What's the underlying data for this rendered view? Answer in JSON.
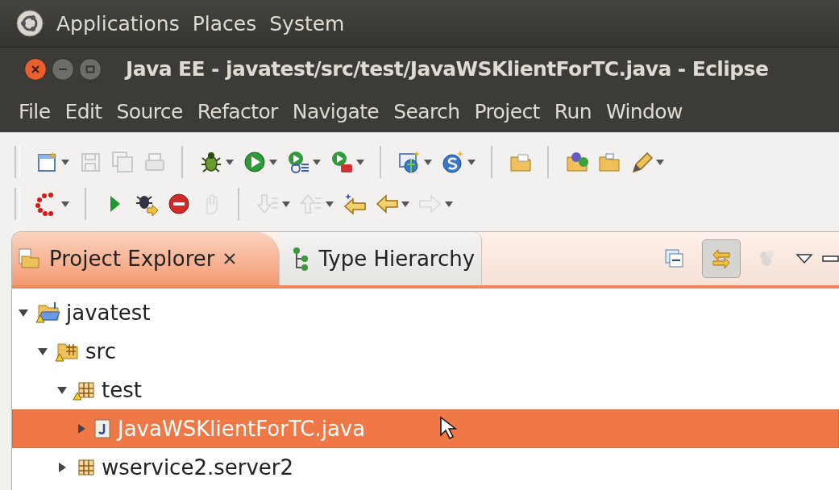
{
  "top_panel": {
    "menus": [
      "Applications",
      "Places",
      "System"
    ]
  },
  "window": {
    "title": "Java EE - javatest/src/test/JavaWSKlientForTC.java - Eclipse"
  },
  "menu_bar": [
    "File",
    "Edit",
    "Source",
    "Refactor",
    "Navigate",
    "Search",
    "Project",
    "Run",
    "Window"
  ],
  "toolbar": [
    {
      "items": [
        {
          "kind": "button",
          "disabled": false,
          "dropdown": true
        },
        {
          "kind": "button",
          "disabled": true,
          "dropdown": false
        },
        {
          "kind": "button",
          "disabled": true,
          "dropdown": false
        },
        {
          "kind": "button",
          "disabled": true,
          "dropdown": false
        },
        {
          "kind": "separator"
        },
        {
          "kind": "button",
          "disabled": false,
          "dropdown": true
        },
        {
          "kind": "button",
          "disabled": false,
          "dropdown": true
        },
        {
          "kind": "button",
          "disabled": false,
          "dropdown": true
        },
        {
          "kind": "button",
          "disabled": false,
          "dropdown": true
        },
        {
          "kind": "separator"
        },
        {
          "kind": "button",
          "disabled": false,
          "dropdown": true
        },
        {
          "kind": "button",
          "disabled": false,
          "dropdown": true
        },
        {
          "kind": "separator"
        },
        {
          "kind": "button",
          "disabled": false,
          "dropdown": false
        },
        {
          "kind": "separator"
        },
        {
          "kind": "button",
          "disabled": false,
          "dropdown": false
        },
        {
          "kind": "button",
          "disabled": false,
          "dropdown": false
        },
        {
          "kind": "button",
          "disabled": false,
          "dropdown": true
        }
      ]
    },
    {
      "items": [
        {
          "kind": "button",
          "disabled": false,
          "dropdown": true
        },
        {
          "kind": "separator"
        },
        {
          "kind": "button",
          "disabled": false,
          "dropdown": false
        },
        {
          "kind": "button",
          "disabled": false,
          "dropdown": false
        },
        {
          "kind": "button",
          "disabled": false,
          "dropdown": false
        },
        {
          "kind": "button",
          "disabled": true,
          "dropdown": false
        },
        {
          "kind": "separator"
        },
        {
          "kind": "button",
          "disabled": true,
          "dropdown": true
        },
        {
          "kind": "button",
          "disabled": true,
          "dropdown": true
        },
        {
          "kind": "button",
          "disabled": false,
          "dropdown": false
        },
        {
          "kind": "button",
          "disabled": false,
          "dropdown": true
        },
        {
          "kind": "button",
          "disabled": true,
          "dropdown": true
        }
      ]
    }
  ],
  "tabs": [
    {
      "label": "Project Explorer",
      "selected": true,
      "closable": true
    },
    {
      "label": "Type Hierarchy",
      "selected": false,
      "closable": false
    }
  ],
  "view_toolbar": [
    {
      "pressed": false,
      "disabled": false
    },
    {
      "pressed": true,
      "disabled": false
    },
    {
      "pressed": false,
      "disabled": true
    }
  ],
  "tree": [
    {
      "label": "javatest",
      "kind": "project",
      "warning": true,
      "expanded": true,
      "selected": false,
      "children": [
        {
          "label": "src",
          "kind": "source_folder",
          "warning": true,
          "expanded": true,
          "selected": false,
          "children": [
            {
              "label": "test",
              "kind": "package",
              "warning": true,
              "expanded": true,
              "selected": false,
              "children": [
                {
                  "label": "JavaWSKlientForTC.java",
                  "kind": "java_file",
                  "warning": false,
                  "expanded": false,
                  "selected": true
                }
              ]
            },
            {
              "label": "wservice2.server2",
              "kind": "package",
              "warning": false,
              "expanded": false,
              "selected": false
            }
          ]
        }
      ]
    }
  ]
}
